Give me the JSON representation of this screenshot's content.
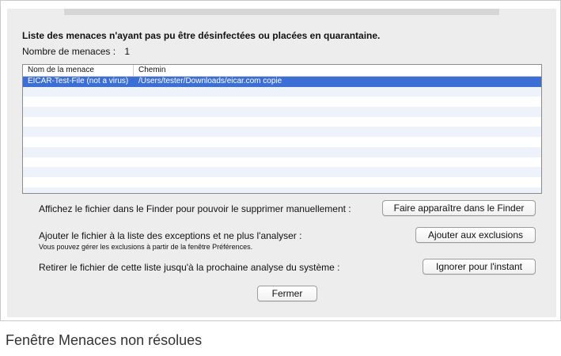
{
  "dialog": {
    "heading": "Liste des menaces n'ayant pas pu être désinfectées ou placées en quarantaine.",
    "count_label": "Nombre de menaces :",
    "count_value": "1"
  },
  "table": {
    "columns": [
      "Nom de la menace",
      "Chemin"
    ],
    "rows": [
      {
        "name": "EICAR-Test-File (not a virus)",
        "path": "/Users/tester/Downloads/eicar.com copie",
        "selected": true
      }
    ]
  },
  "actions": {
    "finder_text": "Affichez le fichier dans le Finder pour pouvoir le supprimer manuellement :",
    "finder_button": "Faire apparaître dans le Finder",
    "exclusion_text": "Ajouter le fichier à la liste des exceptions et ne plus l'analyser :",
    "exclusion_subtext": "Vous pouvez gérer les exclusions à partir de la fenêtre Préférences.",
    "exclusion_button": "Ajouter aux exclusions",
    "ignore_text": "Retirer le fichier de cette liste jusqu'à la prochaine analyse du système :",
    "ignore_button": "Ignorer pour l'instant",
    "close_button": "Fermer"
  },
  "caption": "Fenêtre Menaces non résolues",
  "colors": {
    "selection": "#3c6fd6",
    "stripe": "#eef3fb"
  }
}
